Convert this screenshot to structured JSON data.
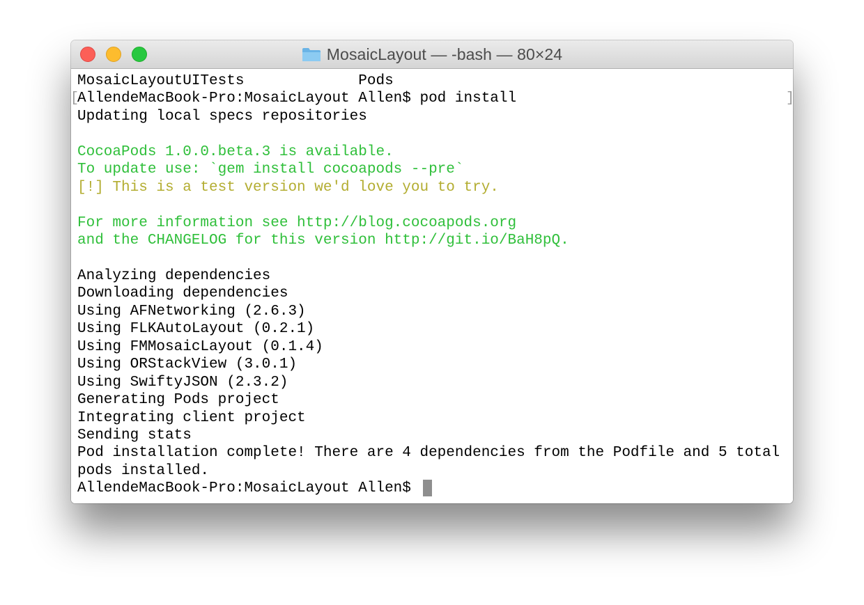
{
  "window": {
    "title": "MosaicLayout — -bash — 80×24",
    "folder_icon": "folder-icon",
    "buttons": {
      "close": "close-button",
      "minimize": "minimize-button",
      "zoom": "zoom-button"
    }
  },
  "colors": {
    "green_text": "#2fbf3a",
    "yellow_text": "#b3ad31",
    "cursor": "#8e8e8e"
  },
  "terminal": {
    "lines": [
      {
        "text": "MosaicLayoutUITests             Pods",
        "style": "normal"
      },
      {
        "text": "AllendeMacBook-Pro:MosaicLayout Allen$ pod install",
        "style": "normal"
      },
      {
        "text": "Updating local specs repositories",
        "style": "normal"
      },
      {
        "text": "",
        "style": "normal"
      },
      {
        "text": "CocoaPods 1.0.0.beta.3 is available.",
        "style": "green"
      },
      {
        "text": "To update use: `gem install cocoapods --pre`",
        "style": "green"
      },
      {
        "text": "[!] This is a test version we'd love you to try.",
        "style": "yellow"
      },
      {
        "text": "",
        "style": "normal"
      },
      {
        "text": "For more information see http://blog.cocoapods.org",
        "style": "green"
      },
      {
        "text": "and the CHANGELOG for this version http://git.io/BaH8pQ.",
        "style": "green"
      },
      {
        "text": "",
        "style": "normal"
      },
      {
        "text": "Analyzing dependencies",
        "style": "normal"
      },
      {
        "text": "Downloading dependencies",
        "style": "normal"
      },
      {
        "text": "Using AFNetworking (2.6.3)",
        "style": "normal"
      },
      {
        "text": "Using FLKAutoLayout (0.2.1)",
        "style": "normal"
      },
      {
        "text": "Using FMMosaicLayout (0.1.4)",
        "style": "normal"
      },
      {
        "text": "Using ORStackView (3.0.1)",
        "style": "normal"
      },
      {
        "text": "Using SwiftyJSON (2.3.2)",
        "style": "normal"
      },
      {
        "text": "Generating Pods project",
        "style": "normal"
      },
      {
        "text": "Integrating client project",
        "style": "normal"
      },
      {
        "text": "Sending stats",
        "style": "normal"
      },
      {
        "text": "Pod installation complete! There are 4 dependencies from the Podfile and 5 total",
        "style": "normal"
      },
      {
        "text": "pods installed.",
        "style": "normal"
      },
      {
        "text": "AllendeMacBook-Pro:MosaicLayout Allen$ ",
        "style": "normal"
      }
    ],
    "bracket_open": "[",
    "bracket_close": "]"
  }
}
